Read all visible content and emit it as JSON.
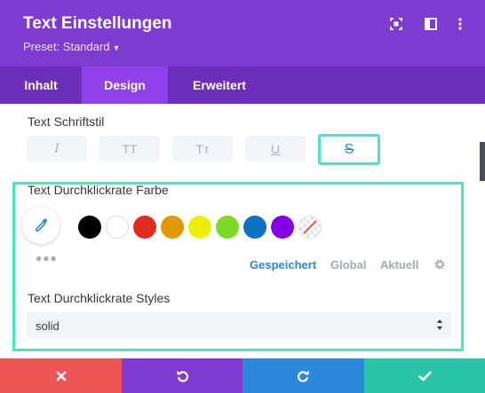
{
  "header": {
    "title": "Text Einstellungen",
    "preset_label": "Preset: Standard",
    "icons": [
      "fullscreen-icon",
      "sidebar-toggle-icon",
      "more-vertical-icon"
    ]
  },
  "tabs": [
    {
      "label": "Inhalt",
      "active": false
    },
    {
      "label": "Design",
      "active": true
    },
    {
      "label": "Erweitert",
      "active": false
    }
  ],
  "font_style": {
    "label": "Text Schriftstil",
    "buttons": [
      {
        "name": "italic",
        "glyph": "I",
        "selected": false
      },
      {
        "name": "uppercase",
        "glyph": "TT",
        "selected": false
      },
      {
        "name": "capitalize",
        "glyph": "Tт",
        "selected": false
      },
      {
        "name": "underline",
        "glyph": "U",
        "selected": false
      },
      {
        "name": "strikethrough",
        "glyph": "S",
        "selected": true
      }
    ]
  },
  "color_section": {
    "label": "Text Durchklickrate Farbe",
    "swatches": [
      "#000000",
      "#ffffff",
      "#e02b20",
      "#e09900",
      "#edf000",
      "#7cda24",
      "#0c71c3",
      "#8300e9",
      "none"
    ],
    "tabs": [
      {
        "label": "Gespeichert",
        "active": true
      },
      {
        "label": "Global",
        "active": false
      },
      {
        "label": "Aktuell",
        "active": false
      }
    ]
  },
  "styles_section": {
    "label": "Text Durchklickrate Styles",
    "value": "solid"
  },
  "footer": {
    "buttons": [
      {
        "name": "cancel",
        "color": "#ef5555"
      },
      {
        "name": "undo",
        "color": "#7e3bd0"
      },
      {
        "name": "redo",
        "color": "#2b87da"
      },
      {
        "name": "save",
        "color": "#29c4a9"
      }
    ]
  },
  "colors": {
    "header_bg": "#7e3bd0",
    "tabs_bg": "#6c2eb9",
    "active_tab_bg": "#8f42ec",
    "highlight": "#4be3c2",
    "accent_blue": "#2b87da"
  }
}
